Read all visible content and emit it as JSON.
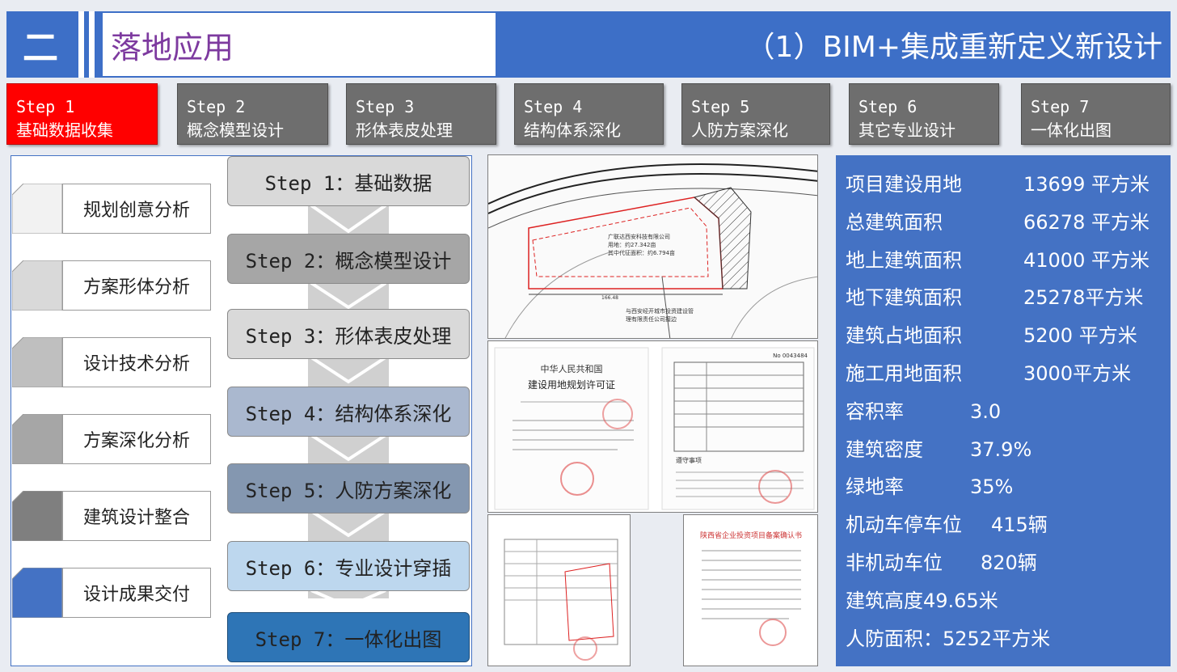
{
  "header": {
    "section_num": "二",
    "title": "落地应用",
    "subtitle": "（1）BIM+集成重新定义新设计",
    "accent": "#3d6fc7",
    "title_color": "#7d3a9f"
  },
  "steps": [
    {
      "num": "Step 1",
      "label": "基础数据收集",
      "active": true
    },
    {
      "num": "Step 2",
      "label": "概念模型设计"
    },
    {
      "num": "Step 3",
      "label": "形体表皮处理"
    },
    {
      "num": "Step 4",
      "label": "结构体系深化"
    },
    {
      "num": "Step 5",
      "label": "人防方案深化"
    },
    {
      "num": "Step 6",
      "label": "其它专业设计"
    },
    {
      "num": "Step 7",
      "label": "一体化出图"
    }
  ],
  "analysis": [
    {
      "label": "规划创意分析",
      "color": "#f2f2f2"
    },
    {
      "label": "方案形体分析",
      "color": "#d9d9d9"
    },
    {
      "label": "设计技术分析",
      "color": "#bfbfbf"
    },
    {
      "label": "方案深化分析",
      "color": "#a6a6a6"
    },
    {
      "label": "建筑设计整合",
      "color": "#7f7f7f"
    },
    {
      "label": "设计成果交付",
      "color": "#4472c4"
    }
  ],
  "flow": [
    {
      "step": "Step 1：",
      "label": "基础数据",
      "color": "#d9d9d9"
    },
    {
      "step": "Step 2：",
      "label": "概念模型设计",
      "color": "#a6a6a6"
    },
    {
      "step": "Step 3：",
      "label": "形体表皮处理",
      "color": "#d9d9d9"
    },
    {
      "step": "Step 4：",
      "label": "结构体系深化",
      "color": "#aab8cf"
    },
    {
      "step": "Step 5：",
      "label": "人防方案深化",
      "color": "#8497b0"
    },
    {
      "step": "Step 6：",
      "label": "专业设计穿插",
      "color": "#bdd7ee"
    },
    {
      "step": "Step 7：",
      "label": "一体化出图",
      "color": "#2e75b6"
    }
  ],
  "documents": {
    "site_plan": {
      "label_a": "广联达西安科技有限公司",
      "label_b": "用地：约27.342亩",
      "label_c": "其中代征面积：约6.794亩",
      "label_d": "与西安经开城市投资建设管",
      "label_e": "理有限责任公司接边",
      "dim": "166.48"
    },
    "permit": {
      "nation": "中华人民共和国",
      "title": "建设用地规划许可证",
      "doc_no": "No 0043484",
      "notes_head": "遵守事项"
    },
    "filing": {
      "title": "陕西省企业投资项目备案确认书"
    }
  },
  "info": [
    {
      "label": "项目建设用地",
      "value": "13699  平方米"
    },
    {
      "label": "总建筑面积",
      "value": "66278  平方米"
    },
    {
      "label": "地上建筑面积",
      "value": "41000   平方米"
    },
    {
      "label": "地下建筑面积",
      "value": "25278平方米"
    },
    {
      "label": "建筑占地面积",
      "value": "5200   平方米"
    },
    {
      "label": "施工用地面积",
      "value": "3000平方米"
    },
    {
      "label": "容积率",
      "value": "3.0"
    },
    {
      "label": "建筑密度",
      "value": "37.9%"
    },
    {
      "label": "绿地率",
      "value": "35%"
    },
    {
      "label": "机动车停车位",
      "value": "415辆"
    },
    {
      "label": "非机动车位",
      "value": "820辆"
    },
    {
      "label": "建筑高度49.65米",
      "value": ""
    },
    {
      "label": "人防面积：5252平方米",
      "value": ""
    }
  ]
}
